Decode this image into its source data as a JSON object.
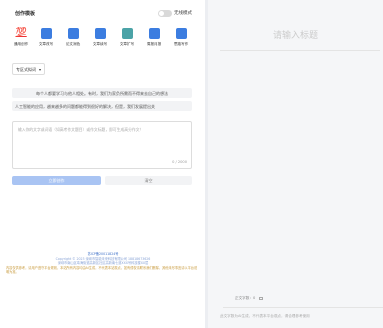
{
  "header": {
    "title": "创作模板",
    "toggle_label": "无线模式"
  },
  "tools": [
    {
      "label": "通用创作",
      "icon": "hundred-icon"
    },
    {
      "label": "文章改写",
      "icon": "edit-doc-icon"
    },
    {
      "label": "论文润色",
      "icon": "user-doc-icon"
    },
    {
      "label": "文章续写",
      "icon": "pen-doc-icon"
    },
    {
      "label": "文章扩写",
      "icon": "expand-doc-icon"
    },
    {
      "label": "周报月报",
      "icon": "report-icon"
    },
    {
      "label": "思路写作",
      "icon": "idea-icon"
    }
  ],
  "select": {
    "value": "专区式拟词"
  },
  "suggestions": [
    "每个人都要学习与他人相处。有时，我们为家负所需而不得来去自己的想法",
    "人工智能的应用，越来越多的问题都能得到很好的解决，但是，我们发展提出关"
  ],
  "textarea": {
    "placeholder": "输入你的文字或词语（如高考作文题目）或作文标题，即可生成高分作文！",
    "counter": "0 / 2000"
  },
  "buttons": {
    "generate": "立即创作",
    "clear": "清空"
  },
  "footer": {
    "icp": "苏ICP备20011824号",
    "copyright": "Copyright © 2023 深圳市智能未来科技有限公司 18818673626",
    "address": "深圳市南山区粤海街道高新区社区高新南七道XXX号科技楼XX层",
    "disclaimer": "内容仅供参考，请用户遵守平台规则，本站所有内容均由AI生成，不代表本站观点，如有侵权请联系我们删除，其他未尽事宜请以平台说明为准。"
  },
  "editor": {
    "title_placeholder": "请输入标题",
    "word_count_label": "正文字数：0",
    "bottom_note": "此文字数为AI生成，不代表本平台观点，请合理参考使用"
  },
  "colors": {
    "accent": "#3c7de0",
    "generate_button": "#a9c4f3",
    "panel_bg": "#f5f6f8"
  }
}
